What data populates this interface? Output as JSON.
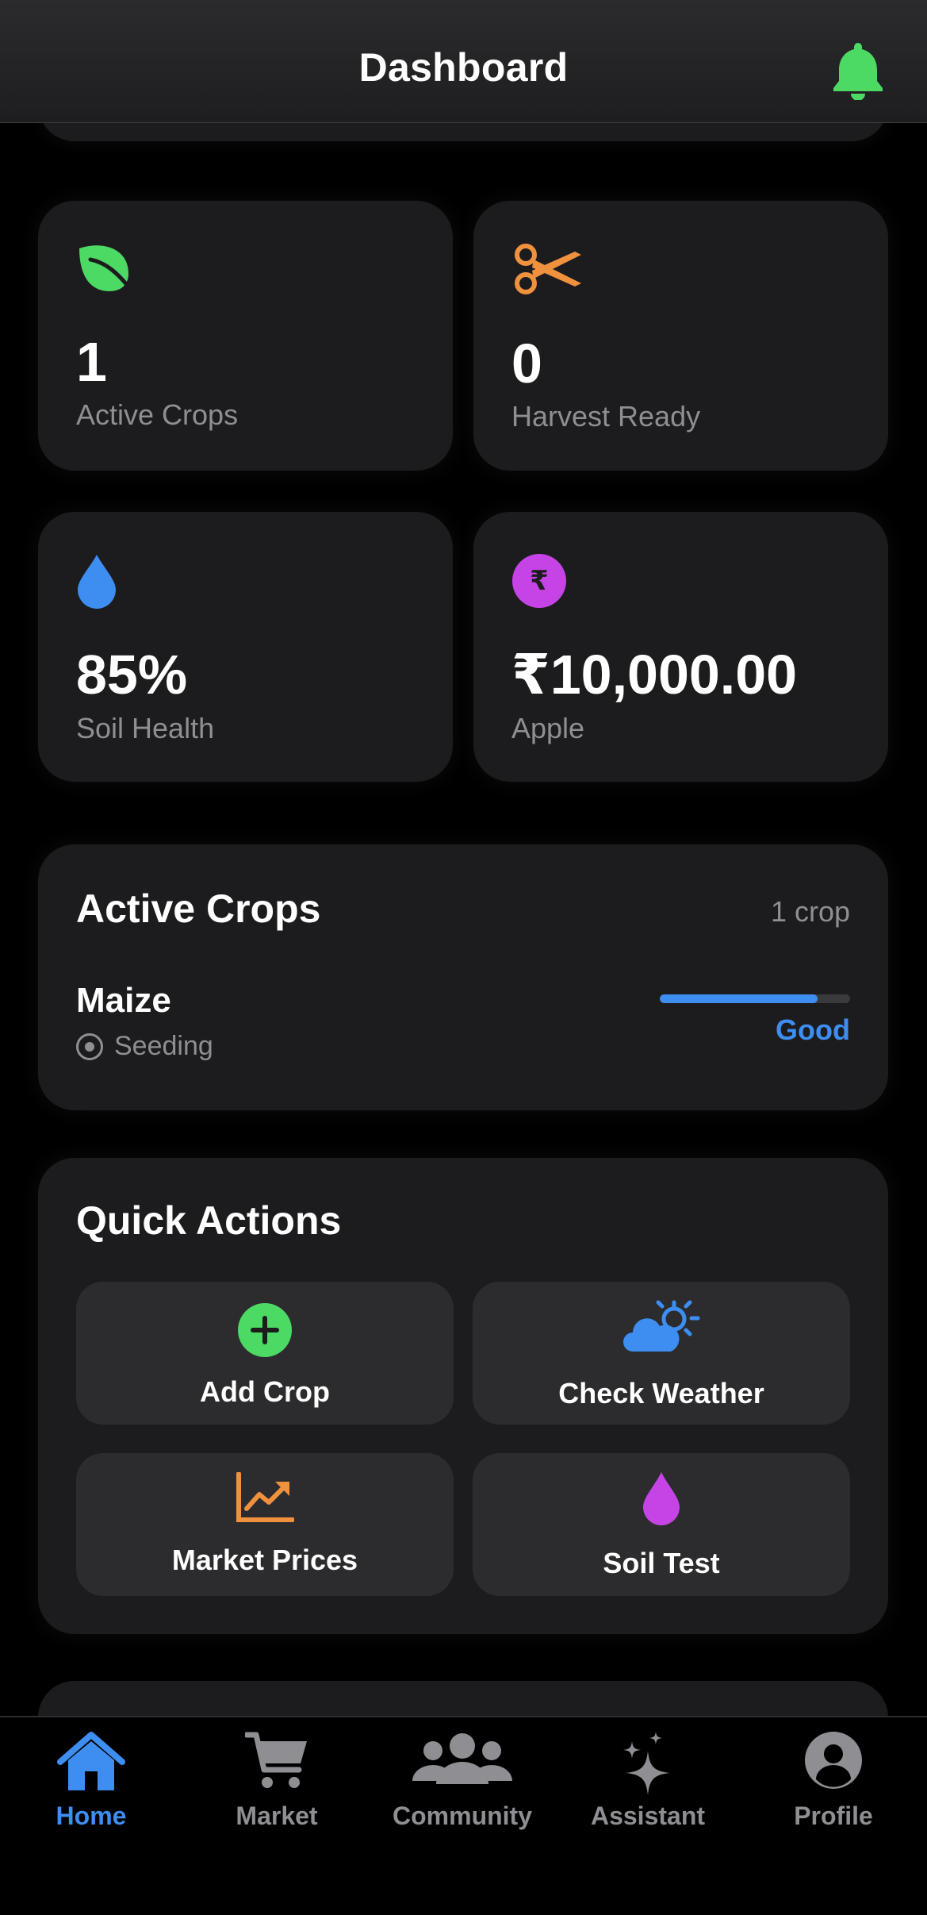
{
  "header": {
    "title": "Dashboard",
    "notification_icon": "bell-icon",
    "accent": "#4cd964"
  },
  "stats": [
    {
      "value": "1",
      "label": "Active Crops",
      "icon": "leaf-icon",
      "color": "#4cd964"
    },
    {
      "value": "0",
      "label": "Harvest Ready",
      "icon": "scissors-icon",
      "color": "#f0913e"
    },
    {
      "value": "85%",
      "label": "Soil Health",
      "icon": "water-drop-icon",
      "color": "#3d8ef0"
    },
    {
      "value": "₹10,000.00",
      "label": "Apple",
      "icon": "rupee-icon",
      "color": "#c644e6"
    }
  ],
  "active_crops": {
    "title": "Active Crops",
    "count": "1 crop",
    "items": [
      {
        "name": "Maize",
        "stage": "Seeding",
        "health": "Good",
        "health_progress": 0.83
      }
    ]
  },
  "quick_actions": {
    "title": "Quick Actions",
    "items": [
      {
        "label": "Add Crop",
        "icon": "plus-circle-icon"
      },
      {
        "label": "Check Weather",
        "icon": "cloud-sun-icon"
      },
      {
        "label": "Market Prices",
        "icon": "chart-trend-icon"
      },
      {
        "label": "Soil Test",
        "icon": "drop-icon"
      }
    ]
  },
  "tabs": [
    {
      "label": "Home",
      "icon": "home-icon",
      "active": true
    },
    {
      "label": "Market",
      "icon": "cart-icon",
      "active": false
    },
    {
      "label": "Community",
      "icon": "people-icon",
      "active": false
    },
    {
      "label": "Assistant",
      "icon": "sparkles-icon",
      "active": false
    },
    {
      "label": "Profile",
      "icon": "person-circle-icon",
      "active": false
    }
  ],
  "colors": {
    "active_tab": "#3d8ef0",
    "inactive": "#8e8e93",
    "card": "#1c1c1e"
  }
}
